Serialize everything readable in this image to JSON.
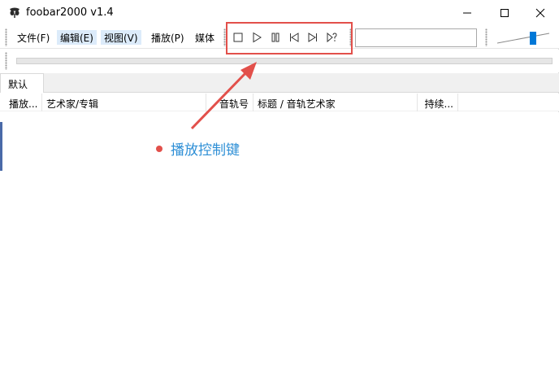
{
  "window": {
    "title": "foobar2000 v1.4"
  },
  "menu": [
    {
      "label": "文件(F)"
    },
    {
      "label": "编辑(E)"
    },
    {
      "label": "视图(V)"
    },
    {
      "label": "播放(P)"
    },
    {
      "label": "媒体"
    }
  ],
  "toolbar": {
    "icons": [
      "stop-icon",
      "play-icon",
      "pause-icon",
      "previous-icon",
      "next-icon",
      "random-icon"
    ],
    "search_value": ""
  },
  "tabs": [
    {
      "label": "默认"
    }
  ],
  "playlist": {
    "columns": [
      {
        "label": "播放..."
      },
      {
        "label": "艺术家/专辑"
      },
      {
        "label": "音轨号"
      },
      {
        "label": "标题 / 音轨艺术家"
      },
      {
        "label": "持续..."
      }
    ]
  },
  "annotation": {
    "label": "播放控制键",
    "color": "#e2504b",
    "text_color": "#2e8fd6"
  },
  "colors": {
    "accent": "#0078d7",
    "menu_highlight": "#dcebfa"
  }
}
